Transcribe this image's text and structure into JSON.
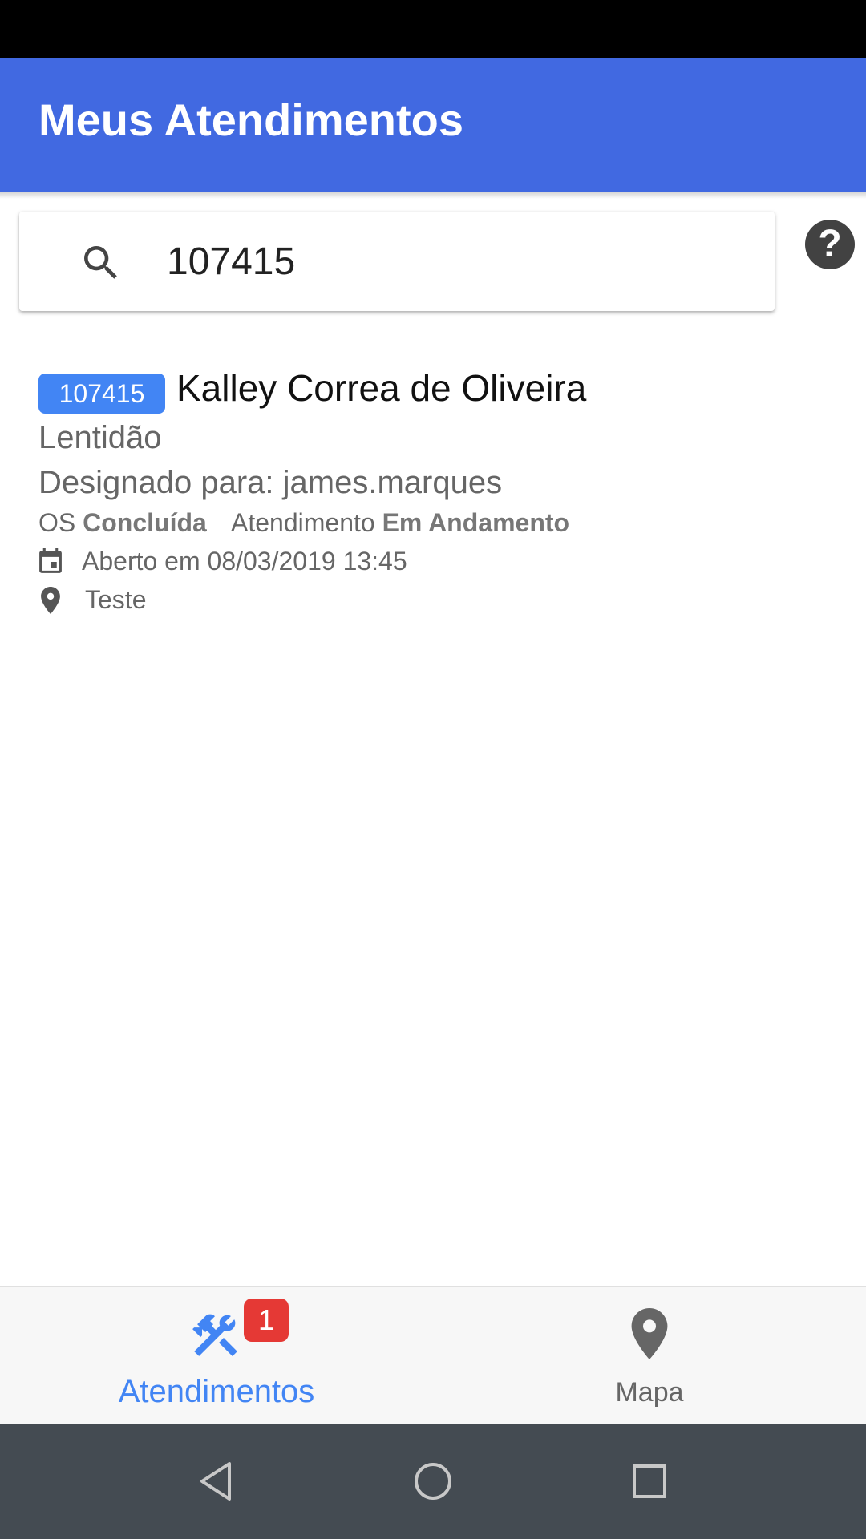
{
  "app_bar": {
    "title": "Meus Atendimentos",
    "color": "#4169e1"
  },
  "search": {
    "value": "107415",
    "icon": "search-icon"
  },
  "help_button": {
    "label": "?"
  },
  "results": [
    {
      "id": "107415",
      "client": "Kalley Correa de Oliveira",
      "subject": "Lentidão",
      "assigned_prefix": "Designado para: ",
      "assigned_to": "james.marques",
      "os_label": "OS",
      "os_status": "Concluída",
      "atend_label": "Atendimento",
      "atend_status": "Em Andamento",
      "opened": "Aberto em 08/03/2019 13:45",
      "location": "Teste"
    }
  ],
  "bottom_nav": {
    "tabs": [
      {
        "label": "Atendimentos",
        "badge": "1",
        "active": true,
        "icon": "tools-icon"
      },
      {
        "label": "Mapa",
        "active": false,
        "icon": "map-pin-icon"
      }
    ],
    "active_color": "#4285f4",
    "badge_color": "#e53935"
  },
  "system_nav": {
    "buttons": [
      "back-icon",
      "home-icon",
      "recents-icon"
    ]
  }
}
